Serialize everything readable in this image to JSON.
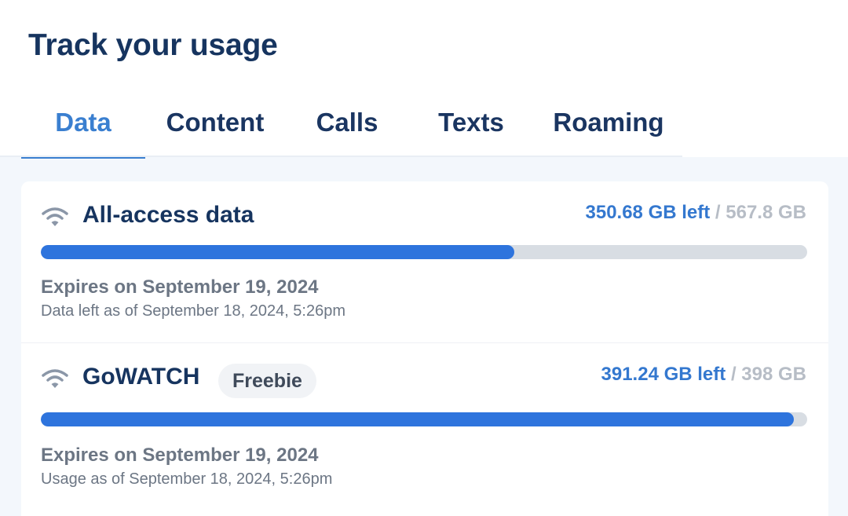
{
  "page": {
    "title": "Track your usage"
  },
  "tabs": [
    {
      "label": "Data",
      "active": true
    },
    {
      "label": "Content",
      "active": false
    },
    {
      "label": "Calls",
      "active": false
    },
    {
      "label": "Texts",
      "active": false
    },
    {
      "label": "Roaming",
      "active": false
    }
  ],
  "usage": [
    {
      "icon": "wifi-icon",
      "name": "All-access data",
      "badge": "",
      "left": "350.68 GB left",
      "separator": "/",
      "total": "567.8 GB",
      "fraction_left": 0.6176,
      "expires": "Expires on September 19, 2024",
      "as_of": "Data left as of September 18, 2024, 5:26pm"
    },
    {
      "icon": "wifi-icon",
      "name": "GoWATCH",
      "badge": "Freebie",
      "left": "391.24 GB left",
      "separator": "/",
      "total": "398 GB",
      "fraction_left": 0.983,
      "expires": "Expires on September 19, 2024",
      "as_of": "Usage as of September 18, 2024, 5:26pm"
    }
  ],
  "colors": {
    "accent": "#3a7fd0",
    "bar_fill": "#2e74dd",
    "bar_track": "#d8dde3",
    "title": "#16345f"
  }
}
